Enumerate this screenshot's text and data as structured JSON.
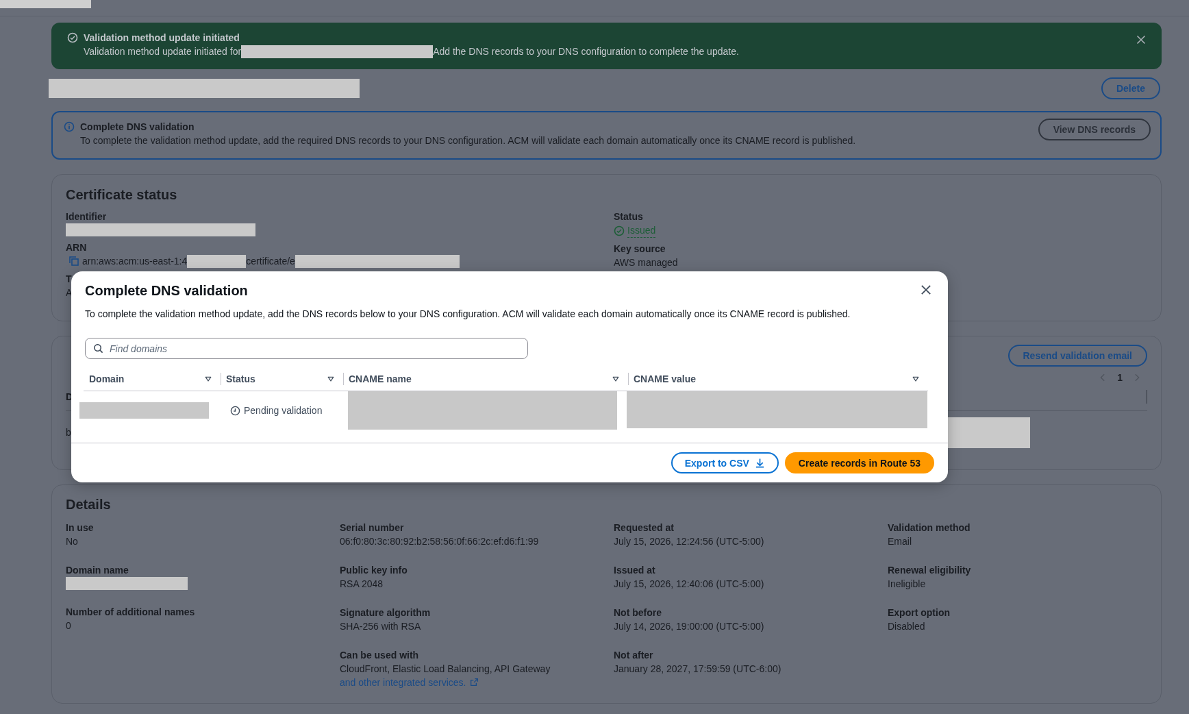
{
  "flash": {
    "title": "Validation method update initiated",
    "message_start": "Validation method update initiated for",
    "message_end": "Add the DNS records to your DNS configuration to complete the update."
  },
  "header": {
    "delete_button": "Delete"
  },
  "info_alert": {
    "title": "Complete DNS validation",
    "message": "To complete the validation method update, add the required DNS records to your DNS configuration. ACM will validate each domain automatically once its CNAME record is published.",
    "button": "View DNS records"
  },
  "certificate_status": {
    "title": "Certificate status",
    "columns": [
      [
        {
          "label": "Identifier",
          "kind": "redacted"
        },
        {
          "label": "ARN",
          "kind": "arn",
          "value_start": "arn:aws:acm:us-east-1:4",
          "value_middle": "certificate/e"
        },
        {
          "label": "T",
          "kind": "text",
          "value": "A"
        }
      ],
      [
        {
          "label": "Status",
          "kind": "status",
          "value": "Issued"
        },
        {
          "label": "Key source",
          "kind": "text",
          "value": "AWS managed"
        }
      ]
    ]
  },
  "domains": {
    "button": "Resend validation email",
    "page": "1",
    "header_cell": "D",
    "row_cell": "b"
  },
  "details": {
    "title": "Details",
    "columns": [
      [
        {
          "label": "In use",
          "kind": "text",
          "value": "No"
        },
        {
          "label": "Domain name",
          "kind": "redacted"
        },
        {
          "label": "Number of additional names",
          "kind": "text",
          "value": "0"
        }
      ],
      [
        {
          "label": "Serial number",
          "kind": "text",
          "value": "06:f0:80:3c:80:92:b2:58:56:0f:66:2c:ef:d6:f1:99"
        },
        {
          "label": "Public key info",
          "kind": "text",
          "value": "RSA 2048"
        },
        {
          "label": "Signature algorithm",
          "kind": "text",
          "value": "SHA-256 with RSA"
        },
        {
          "label": "Can be used with",
          "kind": "link_text",
          "value": "CloudFront, Elastic Load Balancing, API Gateway",
          "link": "and other integrated services."
        }
      ],
      [
        {
          "label": "Requested at",
          "kind": "text",
          "value": "July 15, 2026, 12:24:56 (UTC-5:00)"
        },
        {
          "label": "Issued at",
          "kind": "text",
          "value": "July 15, 2026, 12:40:06 (UTC-5:00)"
        },
        {
          "label": "Not before",
          "kind": "text",
          "value": "July 14, 2026, 19:00:00 (UTC-5:00)"
        },
        {
          "label": "Not after",
          "kind": "text",
          "value": "January 28, 2027, 17:59:59 (UTC-6:00)"
        }
      ],
      [
        {
          "label": "Validation method",
          "kind": "text",
          "value": "Email"
        },
        {
          "label": "Renewal eligibility",
          "kind": "text",
          "value": "Ineligible"
        },
        {
          "label": "Export option",
          "kind": "text",
          "value": "Disabled"
        }
      ]
    ]
  },
  "modal": {
    "title": "Complete DNS validation",
    "description": "To complete the validation method update, add the DNS records below to your DNS configuration. ACM will validate each domain automatically once its CNAME record is published.",
    "search": {
      "placeholder": "Find domains"
    },
    "columns": [
      {
        "label": "Domain"
      },
      {
        "label": "Status"
      },
      {
        "label": "CNAME name"
      },
      {
        "label": "CNAME value"
      }
    ],
    "rows": [
      {
        "cells": [
          {
            "kind": "redacted"
          },
          {
            "kind": "pending",
            "text": "Pending validation"
          },
          {
            "kind": "redacted"
          },
          {
            "kind": "redacted"
          }
        ]
      }
    ],
    "buttons": [
      {
        "label": "Export to CSV",
        "kind": "secondary"
      },
      {
        "label": "Create records in Route 53",
        "kind": "primary"
      }
    ]
  }
}
